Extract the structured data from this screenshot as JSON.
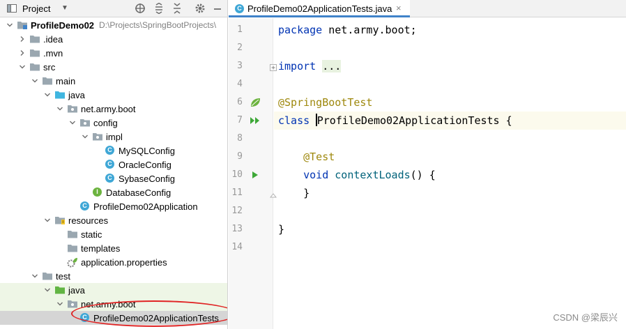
{
  "project_panel": {
    "title": "Project",
    "tree": [
      {
        "label": "ProfileDemo02",
        "path": "D:\\Projects\\SpringBootProjects\\",
        "depth": 0,
        "icon": "module-folder-icon",
        "expanded": true,
        "bold": true
      },
      {
        "label": ".idea",
        "depth": 1,
        "icon": "folder-icon",
        "expanded": false
      },
      {
        "label": ".mvn",
        "depth": 1,
        "icon": "folder-icon",
        "expanded": false
      },
      {
        "label": "src",
        "depth": 1,
        "icon": "folder-icon",
        "expanded": true
      },
      {
        "label": "main",
        "depth": 2,
        "icon": "folder-icon",
        "expanded": true
      },
      {
        "label": "java",
        "depth": 3,
        "icon": "source-folder-icon",
        "expanded": true
      },
      {
        "label": "net.army.boot",
        "depth": 4,
        "icon": "package-icon",
        "expanded": true
      },
      {
        "label": "config",
        "depth": 5,
        "icon": "package-icon",
        "expanded": true
      },
      {
        "label": "impl",
        "depth": 6,
        "icon": "package-icon",
        "expanded": true
      },
      {
        "label": "MySQLConfig",
        "depth": 7,
        "icon": "class-icon",
        "leaf": true
      },
      {
        "label": "OracleConfig",
        "depth": 7,
        "icon": "class-icon",
        "leaf": true
      },
      {
        "label": "SybaseConfig",
        "depth": 7,
        "icon": "class-icon",
        "leaf": true
      },
      {
        "label": "DatabaseConfig",
        "depth": 6,
        "icon": "interface-icon",
        "leaf": true
      },
      {
        "label": "ProfileDemo02Application",
        "depth": 5,
        "icon": "spring-class-icon",
        "leaf": true
      },
      {
        "label": "resources",
        "depth": 3,
        "icon": "resources-folder-icon",
        "expanded": true
      },
      {
        "label": "static",
        "depth": 4,
        "icon": "folder-icon",
        "leaf": true
      },
      {
        "label": "templates",
        "depth": 4,
        "icon": "folder-icon",
        "leaf": true
      },
      {
        "label": "application.properties",
        "depth": 4,
        "icon": "spring-properties-icon",
        "leaf": true
      },
      {
        "label": "test",
        "depth": 2,
        "icon": "folder-icon",
        "expanded": true
      },
      {
        "label": "java",
        "depth": 3,
        "icon": "test-source-folder-icon",
        "expanded": true,
        "highlight": "green"
      },
      {
        "label": "net.army.boot",
        "depth": 4,
        "icon": "package-icon",
        "expanded": true,
        "highlight": "green"
      },
      {
        "label": "ProfileDemo02ApplicationTests",
        "depth": 5,
        "icon": "test-class-icon",
        "leaf": true,
        "highlight": "selected"
      }
    ]
  },
  "editor": {
    "tab": {
      "label": "ProfileDemo02ApplicationTests.java",
      "close": "×"
    },
    "lines": [
      {
        "n": "1",
        "tokens": [
          [
            "kw",
            "package"
          ],
          [
            "",
            " net.army.boot;"
          ]
        ]
      },
      {
        "n": "2",
        "tokens": []
      },
      {
        "n": "3",
        "tokens": [
          [
            "kw",
            "import"
          ],
          [
            "",
            " "
          ],
          [
            "fold-txt",
            "..."
          ]
        ],
        "gutter": "fold"
      },
      {
        "n": "4",
        "tokens": []
      },
      {
        "n": "6",
        "tokens": [
          [
            "ann",
            "@SpringBootTest"
          ]
        ],
        "gutter": "spring-leaf"
      },
      {
        "n": "7",
        "tokens": [
          [
            "kw",
            "class"
          ],
          [
            "",
            " "
          ],
          [
            "caret",
            ""
          ],
          [
            "",
            "ProfileDemo02ApplicationTests {"
          ]
        ],
        "gutter": "run-double",
        "current": true
      },
      {
        "n": "8",
        "tokens": []
      },
      {
        "n": "9",
        "tokens": [
          [
            "",
            "    "
          ],
          [
            "ann",
            "@Test"
          ]
        ]
      },
      {
        "n": "10",
        "tokens": [
          [
            "",
            "    "
          ],
          [
            "kw",
            "void"
          ],
          [
            "",
            " "
          ],
          [
            "fn",
            "contextLoads"
          ],
          [
            "",
            "() {"
          ]
        ],
        "gutter": "run-single"
      },
      {
        "n": "11",
        "tokens": [
          [
            "",
            "    }"
          ]
        ],
        "gutter": "fold-end"
      },
      {
        "n": "12",
        "tokens": []
      },
      {
        "n": "13",
        "tokens": [
          [
            "",
            "}"
          ]
        ]
      },
      {
        "n": "14",
        "tokens": []
      }
    ]
  },
  "watermark": "CSDN @梁辰兴",
  "colors": {
    "accent": "#4083c9",
    "annotation": "#e02424",
    "run_green": "#3ea838"
  }
}
